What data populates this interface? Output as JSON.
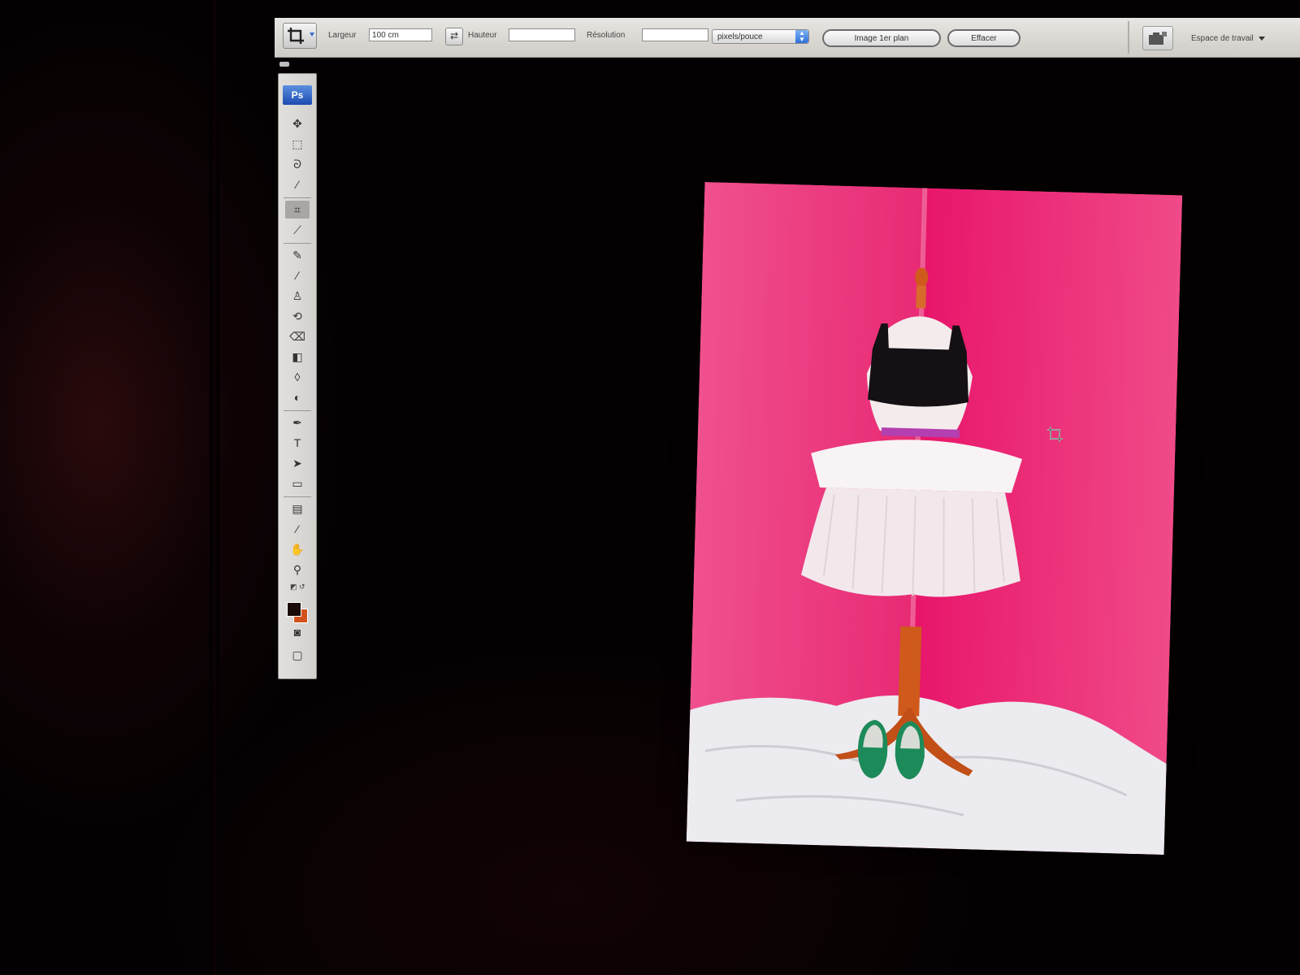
{
  "options_bar": {
    "width_label": "Largeur",
    "width_value": "100 cm",
    "height_label": "Hauteur",
    "height_value": "",
    "resolution_label": "Résolution",
    "resolution_value": "",
    "unit_select": "pixels/pouce",
    "front_image_button": "Image 1er plan",
    "clear_button": "Effacer",
    "workspace_label": "Espace de travail"
  },
  "toolbox": {
    "logo": "Ps",
    "tools": [
      {
        "name": "move-tool-icon",
        "glyph": "✥"
      },
      {
        "name": "marquee-tool-icon",
        "glyph": "⬚"
      },
      {
        "name": "lasso-tool-icon",
        "glyph": "ᘐ"
      },
      {
        "name": "magic-wand-tool-icon",
        "glyph": "⁄"
      },
      {
        "name": "crop-tool-icon",
        "glyph": "⌗"
      },
      {
        "name": "slice-tool-icon",
        "glyph": "⟋"
      },
      {
        "name": "healing-brush-tool-icon",
        "glyph": "✎"
      },
      {
        "name": "brush-tool-icon",
        "glyph": "∕"
      },
      {
        "name": "clone-stamp-tool-icon",
        "glyph": "♙"
      },
      {
        "name": "history-brush-tool-icon",
        "glyph": "⟲"
      },
      {
        "name": "eraser-tool-icon",
        "glyph": "⌫"
      },
      {
        "name": "gradient-tool-icon",
        "glyph": "◧"
      },
      {
        "name": "blur-tool-icon",
        "glyph": "◊"
      },
      {
        "name": "dodge-tool-icon",
        "glyph": "◐"
      },
      {
        "name": "pen-tool-icon",
        "glyph": "✒"
      },
      {
        "name": "type-tool-icon",
        "glyph": "T"
      },
      {
        "name": "path-selection-tool-icon",
        "glyph": "➤"
      },
      {
        "name": "shape-tool-icon",
        "glyph": "▭"
      },
      {
        "name": "notes-tool-icon",
        "glyph": "▤"
      },
      {
        "name": "eyedropper-tool-icon",
        "glyph": "⁄"
      },
      {
        "name": "hand-tool-icon",
        "glyph": "✋"
      },
      {
        "name": "zoom-tool-icon",
        "glyph": "⚲"
      }
    ],
    "active_tool": "crop-tool-icon",
    "foreground_color": "#1a0b08",
    "background_color": "#d2521c"
  },
  "colors": {
    "backdrop_pink": "#e8176a",
    "tulle_white": "#f6f0f2",
    "top_black": "#141014",
    "shoe_green": "#1d8a5a",
    "stand_orange": "#d05a1c"
  }
}
